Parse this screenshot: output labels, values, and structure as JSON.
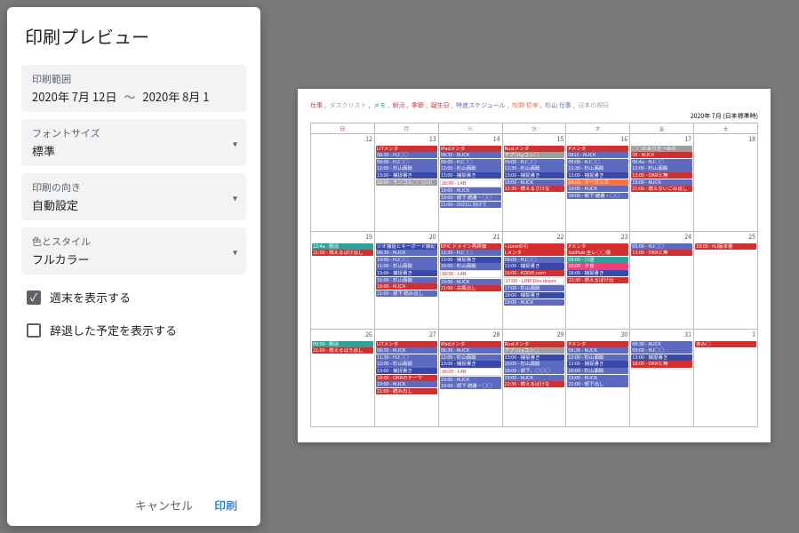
{
  "dialog": {
    "title": "印刷プレビュー",
    "range": {
      "label": "印刷範囲",
      "from": "2020年 7月 12日",
      "sep": "〜",
      "to": "2020年 8月 1"
    },
    "font": {
      "label": "フォントサイズ",
      "value": "標準"
    },
    "orient": {
      "label": "印刷の向き",
      "value": "自動設定"
    },
    "style": {
      "label": "色とスタイル",
      "value": "フルカラー"
    },
    "showWeekend": "週末を表示する",
    "showDeclined": "辞退した予定を表示する",
    "cancel": "キャンセル",
    "print": "印刷"
  },
  "preview": {
    "legendItems": [
      {
        "t": "仕事",
        "c": "#d32f2f"
      },
      {
        "t": "タスクリスト",
        "c": "#9e9e9e"
      },
      {
        "t": "メモ",
        "c": "#26a69a"
      },
      {
        "t": "朝活",
        "c": "#ec407a"
      },
      {
        "t": "季節",
        "c": "#d32f2f"
      },
      {
        "t": "誕生日",
        "c": "#d32f2f"
      },
      {
        "t": "特進スケジュール",
        "c": "#5c6bc0"
      },
      {
        "t": "牧野 哲孝",
        "c": "#ff7043"
      },
      {
        "t": "杉山 仕事",
        "c": "#5c6bc0"
      },
      {
        "t": "日本の祝日",
        "c": "#9e9e9e"
      }
    ],
    "headerRight": "2020年 7月 (日本標準時)",
    "dow": [
      "日",
      "月",
      "火",
      "水",
      "木",
      "金",
      "土"
    ],
    "weeks": [
      {
        "days": [
          {
            "n": "12",
            "ev": []
          },
          {
            "n": "13",
            "ev": [
              {
                "t": "LITメンタ",
                "c": "c-red"
              },
              {
                "t": "08:30 - HJ○○",
                "c": "c-blue"
              },
              {
                "t": "09:00 - HJ○○",
                "c": "c-blue"
              },
              {
                "t": "12:00 - 杉山面談",
                "c": "c-blue"
              },
              {
                "t": "13:00 - 捕捉書き",
                "c": "c-dblue"
              },
              {
                "t": "18:00 - モンゴル○○(2 0)",
                "c": "c-gray"
              }
            ]
          },
          {
            "n": "14",
            "ev": [
              {
                "t": "iPadメンタ",
                "c": "c-red"
              },
              {
                "t": "08:30 - MJCK",
                "c": "c-blue"
              },
              {
                "t": "09:00 - HJ○○",
                "c": "c-blue"
              },
              {
                "t": "12:00 - 杉山面談",
                "c": "c-blue"
              },
              {
                "t": "13:00 - 捕捉書き",
                "c": "c-dblue"
              },
              {
                "t": "18:00 - L4B",
                "c": "c-white"
              },
              {
                "t": "19:00 - MJCK",
                "c": "c-blue"
              },
              {
                "t": "19:00 - 部下 読書・○○",
                "c": "c-blue"
              },
              {
                "t": "21:00 - 2021に向けて",
                "c": "c-blue"
              }
            ]
          },
          {
            "n": "15",
            "ev": [
              {
                "t": "Rustメンタ",
                "c": "c-red"
              },
              {
                "t": "アプリLyコン○",
                "c": "c-gray"
              },
              {
                "t": "09:00 - HJ○○",
                "c": "c-blue"
              },
              {
                "t": "11:30 - 杉山面談",
                "c": "c-blue"
              },
              {
                "t": "13:00 - 捕捉書き",
                "c": "c-dblue"
              },
              {
                "t": "19:00 - MJCK",
                "c": "c-blue"
              },
              {
                "t": "22:30 - 燃えるさけな",
                "c": "c-red"
              }
            ]
          },
          {
            "n": "16",
            "ev": [
              {
                "t": "Pメンタ",
                "c": "c-red"
              },
              {
                "t": "0815 - MJCK",
                "c": "c-blue"
              },
              {
                "t": "09:00 - HJ○○",
                "c": "c-blue"
              },
              {
                "t": "11:30 - 杉山面談",
                "c": "c-blue"
              },
              {
                "t": "13:00 - 捕捉書き",
                "c": "c-dblue"
              },
              {
                "t": "14:00 - オーガシズ",
                "c": "c-orange"
              },
              {
                "t": "19:00 - MJCK",
                "c": "c-blue"
              },
              {
                "t": "19:00 - 部下 読書・○○",
                "c": "c-blue"
              }
            ]
          },
          {
            "n": "17",
            "ev": [
              {
                "t": "○○のありき→あの",
                "c": "c-gray"
              },
              {
                "t": "08 - MJCK",
                "c": "c-red"
              },
              {
                "t": "08:4a - HJ○○",
                "c": "c-blue"
              },
              {
                "t": "12:00 - 杉山面談",
                "c": "c-blue"
              },
              {
                "t": "13:00 - OKRと無",
                "c": "c-red"
              },
              {
                "t": "19:00 - MJCK",
                "c": "c-blue"
              },
              {
                "t": "21:00 - 燃えないごみ出し",
                "c": "c-red"
              }
            ]
          },
          {
            "n": "18",
            "ev": []
          }
        ]
      },
      {
        "days": [
          {
            "n": "19",
            "ev": [
              {
                "t": "12:4a - 朝活",
                "c": "c-green"
              },
              {
                "t": "21:00 - 燃えるばけ出し",
                "c": "c-red"
              }
            ]
          },
          {
            "n": "20",
            "ev": [
              {
                "t": "ジオ捕捉とキーボード雑記",
                "c": "c-dblue"
              },
              {
                "t": "",
                "c": ""
              },
              {
                "t": "08:30 - MJCK",
                "c": "c-blue"
              },
              {
                "t": "10:00 - HJ○○",
                "c": "c-blue"
              },
              {
                "t": "11:00 - 杉山面談",
                "c": "c-blue"
              },
              {
                "t": "13:00 - 捕捉書き",
                "c": "c-dblue"
              },
              {
                "t": "16:00 - 杉山面談",
                "c": "c-blue"
              },
              {
                "t": "18:00 - MJCK",
                "c": "c-red"
              },
              {
                "t": "21:00 - 部下 読み出し",
                "c": "c-blue"
              }
            ]
          },
          {
            "n": "21",
            "ev": [
              {
                "t": "EPIC ドメイン再評価",
                "c": "c-red"
              },
              {
                "t": "",
                "c": ""
              },
              {
                "t": "11:30 - HJ○○",
                "c": "c-blue"
              },
              {
                "t": "13:00 - 捕捉書き",
                "c": "c-dblue"
              },
              {
                "t": "16:00 - 杉山面談",
                "c": "c-blue"
              },
              {
                "t": "18:00 - L4B",
                "c": "c-white"
              },
              {
                "t": "19:00 - MJCK",
                "c": "c-blue"
              },
              {
                "t": "21:00 - 古瓶出し",
                "c": "c-red"
              }
            ]
          },
          {
            "n": "22",
            "ev": [
              {
                "t": "+Juneの引",
                "c": "c-red"
              },
              {
                "t": "Lメンタ",
                "c": "c-red"
              },
              {
                "t": "09:00 - HJ○○",
                "c": "c-blue"
              },
              {
                "t": "13:00 - 捕捉書き",
                "c": "c-dblue"
              },
              {
                "t": "16:00 - KDDIE.com",
                "c": "c-red"
              },
              {
                "t": "17:00 - LINE Dev doper",
                "c": "c-white"
              },
              {
                "t": "17:00 - 杉山面談",
                "c": "c-blue"
              },
              {
                "t": "18:00 - 捕捉書き",
                "c": "c-dblue"
              },
              {
                "t": "19:00 - MJCK",
                "c": "c-blue"
              }
            ]
          },
          {
            "n": "23",
            "ev": [
              {
                "t": "Pメンタ",
                "c": "c-red"
              },
              {
                "t": "IzziHub 全レ○○像",
                "c": "c-red"
              },
              {
                "t": "09:00 - 川遊",
                "c": "c-green"
              },
              {
                "t": "10:00 - 夕食",
                "c": "c-pink"
              },
              {
                "t": "18:00 - 捕捉書き",
                "c": "c-dblue"
              },
              {
                "t": "22:30 - 燃えるばけ出",
                "c": "c-red"
              }
            ]
          },
          {
            "n": "24",
            "ev": [
              {
                "t": "09:00 - HJ○○",
                "c": "c-blue"
              },
              {
                "t": "13:00 - OKRと無",
                "c": "c-red"
              }
            ]
          },
          {
            "n": "25",
            "ev": [
              {
                "t": "19:00 - HJ版本書",
                "c": "c-red"
              }
            ]
          }
        ]
      },
      {
        "days": [
          {
            "n": "26",
            "ev": [
              {
                "t": "09:00 - 朝活",
                "c": "c-green"
              },
              {
                "t": "21:00 - 燃えるばろ出し",
                "c": "c-red"
              }
            ]
          },
          {
            "n": "27",
            "ev": [
              {
                "t": "LITメンタ",
                "c": "c-red"
              },
              {
                "t": "08:30 - MJCK",
                "c": "c-blue"
              },
              {
                "t": "11:30 - HJ○○",
                "c": "c-blue"
              },
              {
                "t": "12:00 - 杉山面談",
                "c": "c-blue"
              },
              {
                "t": "13:00 - 捕捉書き",
                "c": "c-dblue"
              },
              {
                "t": "18:00 - OKRのテーマ",
                "c": "c-red"
              },
              {
                "t": "19:00 - MJCK",
                "c": "c-blue"
              },
              {
                "t": "21:00 - 読み出し",
                "c": "c-red"
              }
            ]
          },
          {
            "n": "28",
            "ev": [
              {
                "t": "iPadメンタ",
                "c": "c-red"
              },
              {
                "t": "08:30 - MJCK",
                "c": "c-blue"
              },
              {
                "t": "12:00 - 杉山面談",
                "c": "c-blue"
              },
              {
                "t": "13:00 - 捕捉書き",
                "c": "c-dblue"
              },
              {
                "t": "18:00 - L4B",
                "c": "c-white"
              },
              {
                "t": "19:00 - MJCK",
                "c": "c-blue"
              },
              {
                "t": "19:00 - 部下 読書・○○",
                "c": "c-blue"
              }
            ]
          },
          {
            "n": "29",
            "ev": [
              {
                "t": "Rustメンタ",
                "c": "c-red"
              },
              {
                "t": "アプリLyコン○",
                "c": "c-gray"
              },
              {
                "t": "13:00 - 捕捉書き",
                "c": "c-dblue"
              },
              {
                "t": "16:00 - 杉山面談",
                "c": "c-blue"
              },
              {
                "t": "18:00 - 部下、○○○",
                "c": "c-blue"
              },
              {
                "t": "19:00 - MJCK",
                "c": "c-blue"
              },
              {
                "t": "22:30 - 燃えるばけな",
                "c": "c-red"
              }
            ]
          },
          {
            "n": "30",
            "ev": [
              {
                "t": "Pメンタ",
                "c": "c-red"
              },
              {
                "t": "08:30 - MJCK",
                "c": "c-blue"
              },
              {
                "t": "12:00 - 杉山面談",
                "c": "c-blue"
              },
              {
                "t": "13:00 - 捕捉書き",
                "c": "c-dblue"
              },
              {
                "t": "16:00 - 杉山面談",
                "c": "c-blue"
              },
              {
                "t": "19:00 - MJCK",
                "c": "c-blue"
              },
              {
                "t": "21:00 - 部下出し",
                "c": "c-blue"
              }
            ]
          },
          {
            "n": "31",
            "ev": [
              {
                "t": "08:30 - MJCK",
                "c": "c-blue"
              },
              {
                "t": "09:00 - HJ○○",
                "c": "c-blue"
              },
              {
                "t": "13:00 - 捕捉書き",
                "c": "c-dblue"
              },
              {
                "t": "18:00 - OKRと無",
                "c": "c-red"
              },
              {
                "t": "",
                "c": "c-white"
              }
            ]
          },
          {
            "n": "1",
            "ev": [
              {
                "t": "休み○",
                "c": "c-red"
              }
            ]
          }
        ]
      }
    ]
  }
}
